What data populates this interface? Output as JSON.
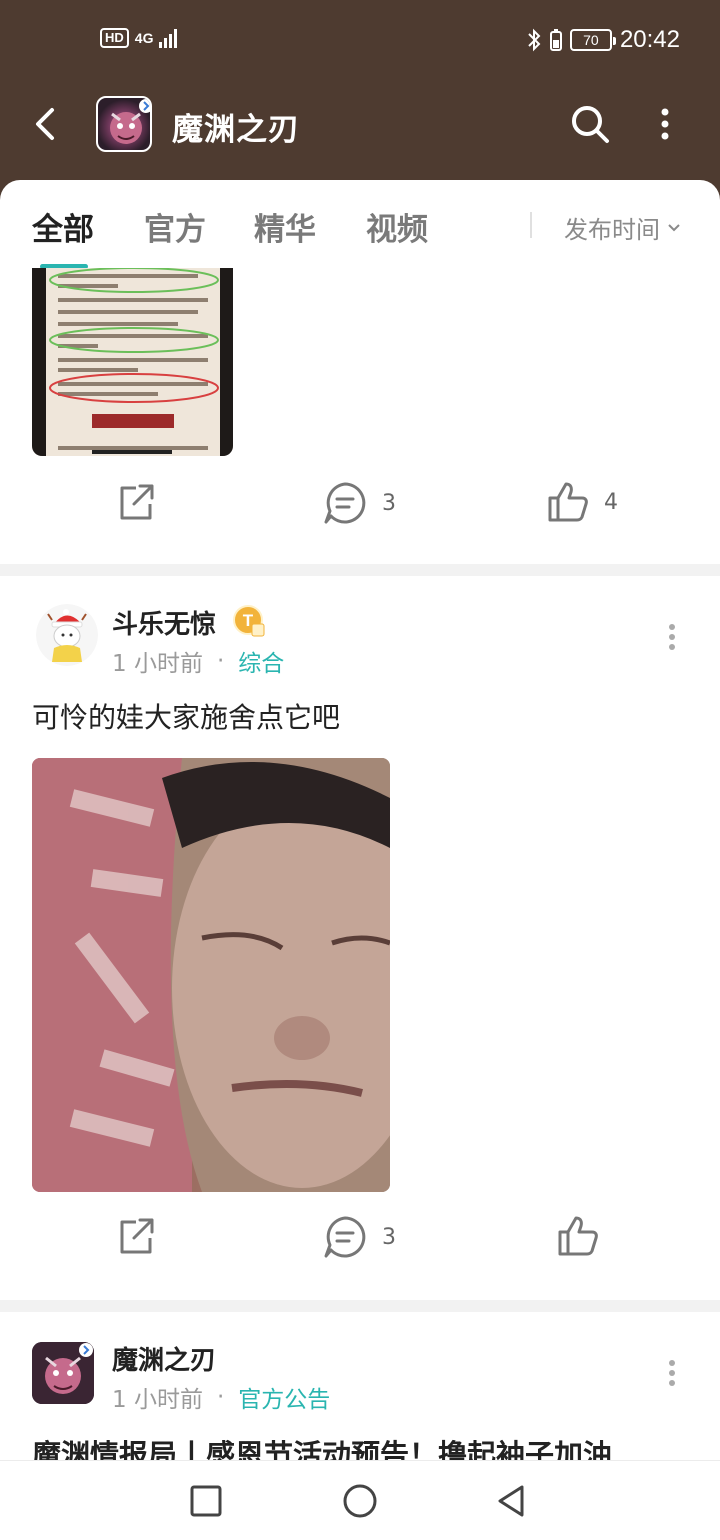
{
  "status_bar": {
    "hd": "HD",
    "network": "4G",
    "battery": "70",
    "time": "20:42"
  },
  "header": {
    "title": "魔渊之刃"
  },
  "tabs": [
    {
      "label": "全部",
      "active": true
    },
    {
      "label": "官方",
      "active": false
    },
    {
      "label": "精华",
      "active": false
    },
    {
      "label": "视频",
      "active": false
    }
  ],
  "sort": {
    "label": "发布时间"
  },
  "post1": {
    "comments": "3",
    "likes": "4"
  },
  "post2": {
    "author": "斗乐无惊",
    "badge": "T",
    "time": "1 小时前",
    "category": "综合",
    "text": "可怜的娃大家施舍点它吧",
    "comments": "3"
  },
  "post3": {
    "author": "魔渊之刃",
    "time": "1 小时前",
    "category": "官方公告",
    "title": "魔渊情报局丨感恩节活动预告！撸起袖子加油"
  },
  "colors": {
    "brand_header": "#4e3b30",
    "accent": "#2ab5b0"
  }
}
